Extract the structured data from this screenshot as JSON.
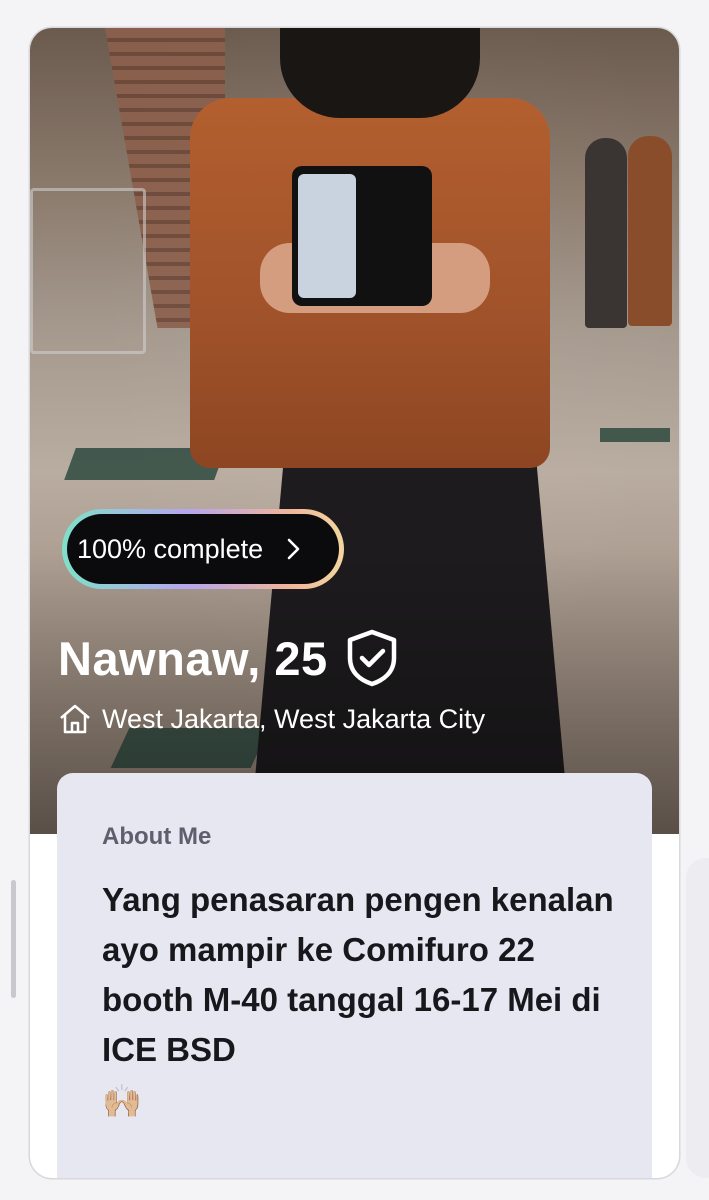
{
  "profile": {
    "progress_label": "100% complete",
    "name_age": "Nawnaw, 25",
    "location": "West Jakarta, West Jakarta City",
    "verified": true
  },
  "about": {
    "title": "About Me",
    "text": "Yang penasaran pengen kenalan ayo mampir ke Comifuro 22 booth M-40 tanggal 16-17 Mei di ICE BSD",
    "emoji": "🙌🏼"
  },
  "icons": {
    "progress": "chevron-right-icon",
    "verified": "shield-check-icon",
    "location": "home-icon"
  },
  "colors": {
    "progress_ring": [
      "#7fe0c8",
      "#b6a5f0",
      "#f0b49a",
      "#f2d6a0"
    ],
    "about_bg": "#e7e7f2"
  }
}
